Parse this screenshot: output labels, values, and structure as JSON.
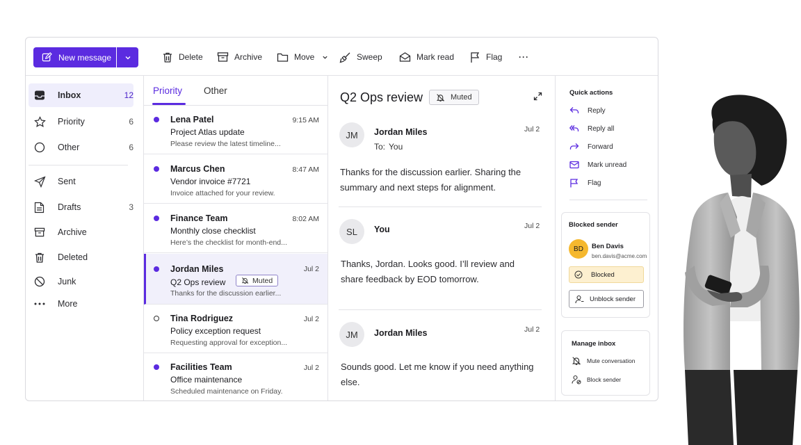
{
  "toolbar": {
    "new_message": "New message",
    "delete": "Delete",
    "archive": "Archive",
    "move": "Move",
    "sweep": "Sweep",
    "mark_read": "Mark read",
    "flag": "Flag",
    "more": "···"
  },
  "folders": [
    {
      "name": "Inbox",
      "count": "12",
      "icon": "inbox-icon",
      "active": true
    },
    {
      "name": "Priority",
      "count": "6",
      "icon": "star-icon"
    },
    {
      "name": "Other",
      "count": "6",
      "icon": "circle-icon"
    },
    {
      "name": "Sent",
      "count": "",
      "icon": "send-icon"
    },
    {
      "name": "Drafts",
      "count": "3",
      "icon": "draft-icon"
    },
    {
      "name": "Archive",
      "count": "",
      "icon": "archive-icon"
    },
    {
      "name": "Deleted",
      "count": "",
      "icon": "trash-icon"
    },
    {
      "name": "Junk",
      "count": "",
      "icon": "junk-icon"
    },
    {
      "name": "More",
      "count": "",
      "icon": "more-icon"
    }
  ],
  "list": {
    "tabs": [
      "Priority",
      "Other"
    ],
    "messages": [
      {
        "sender": "Lena Patel",
        "time": "9:15 AM",
        "subject": "Project Atlas update",
        "preview": "Please review the latest timeline...",
        "unread": true
      },
      {
        "sender": "Marcus Chen",
        "time": "8:47 AM",
        "subject": "Vendor invoice #7721",
        "preview": "Invoice attached for your review.",
        "unread": true
      },
      {
        "sender": "Finance Team",
        "time": "8:02 AM",
        "subject": "Monthly close checklist",
        "preview": "Here’s the checklist for month-end...",
        "unread": true
      },
      {
        "sender": "Jordan Miles",
        "time": "Jul 2",
        "subject": "Q2 Ops review",
        "preview": "Thanks for the discussion earlier...",
        "unread": true,
        "selected": true,
        "badge": "Muted"
      },
      {
        "sender": "Tina Rodriguez",
        "time": "Jul 2",
        "subject": "Policy exception request",
        "preview": "Requesting approval for exception...",
        "unread": false
      },
      {
        "sender": "Facilities Team",
        "time": "Jul 2",
        "subject": "Office maintenance",
        "preview": "Scheduled maintenance on Friday.",
        "unread": true
      }
    ]
  },
  "reading": {
    "title": "Q2 Ops review",
    "badge": "Muted",
    "messages": [
      {
        "initials": "JM",
        "name": "Jordan Miles",
        "date": "Jul 2",
        "to_label": "To:",
        "to": "You",
        "body": "Thanks for the discussion earlier. Sharing the summary and next steps for alignment."
      },
      {
        "initials": "SL",
        "name": "You",
        "date": "Jul 2",
        "body": "Thanks, Jordan. Looks good. I’ll review and share feedback by EOD tomorrow."
      },
      {
        "initials": "JM",
        "name": "Jordan Miles",
        "date": "Jul 2",
        "body": "Sounds good. Let me know if you need anything else."
      }
    ]
  },
  "side": {
    "quick_actions_title": "Quick actions",
    "quick_actions": [
      "Reply",
      "Reply all",
      "Forward",
      "Mark unread",
      "Flag"
    ],
    "blocked": {
      "title": "Blocked sender",
      "initials": "BD",
      "name": "Ben Davis",
      "email": "ben.davis@acme.com",
      "status": "Blocked",
      "unblock": "Unblock sender"
    },
    "manage": {
      "title": "Manage inbox",
      "items": [
        "Mute conversation",
        "Block sender"
      ]
    }
  },
  "colors": {
    "accent": "#5b2be0",
    "accent_light": "#efeefc",
    "avatar_yellow": "#f5b82e",
    "blocked_bg": "#fdf0d0"
  }
}
